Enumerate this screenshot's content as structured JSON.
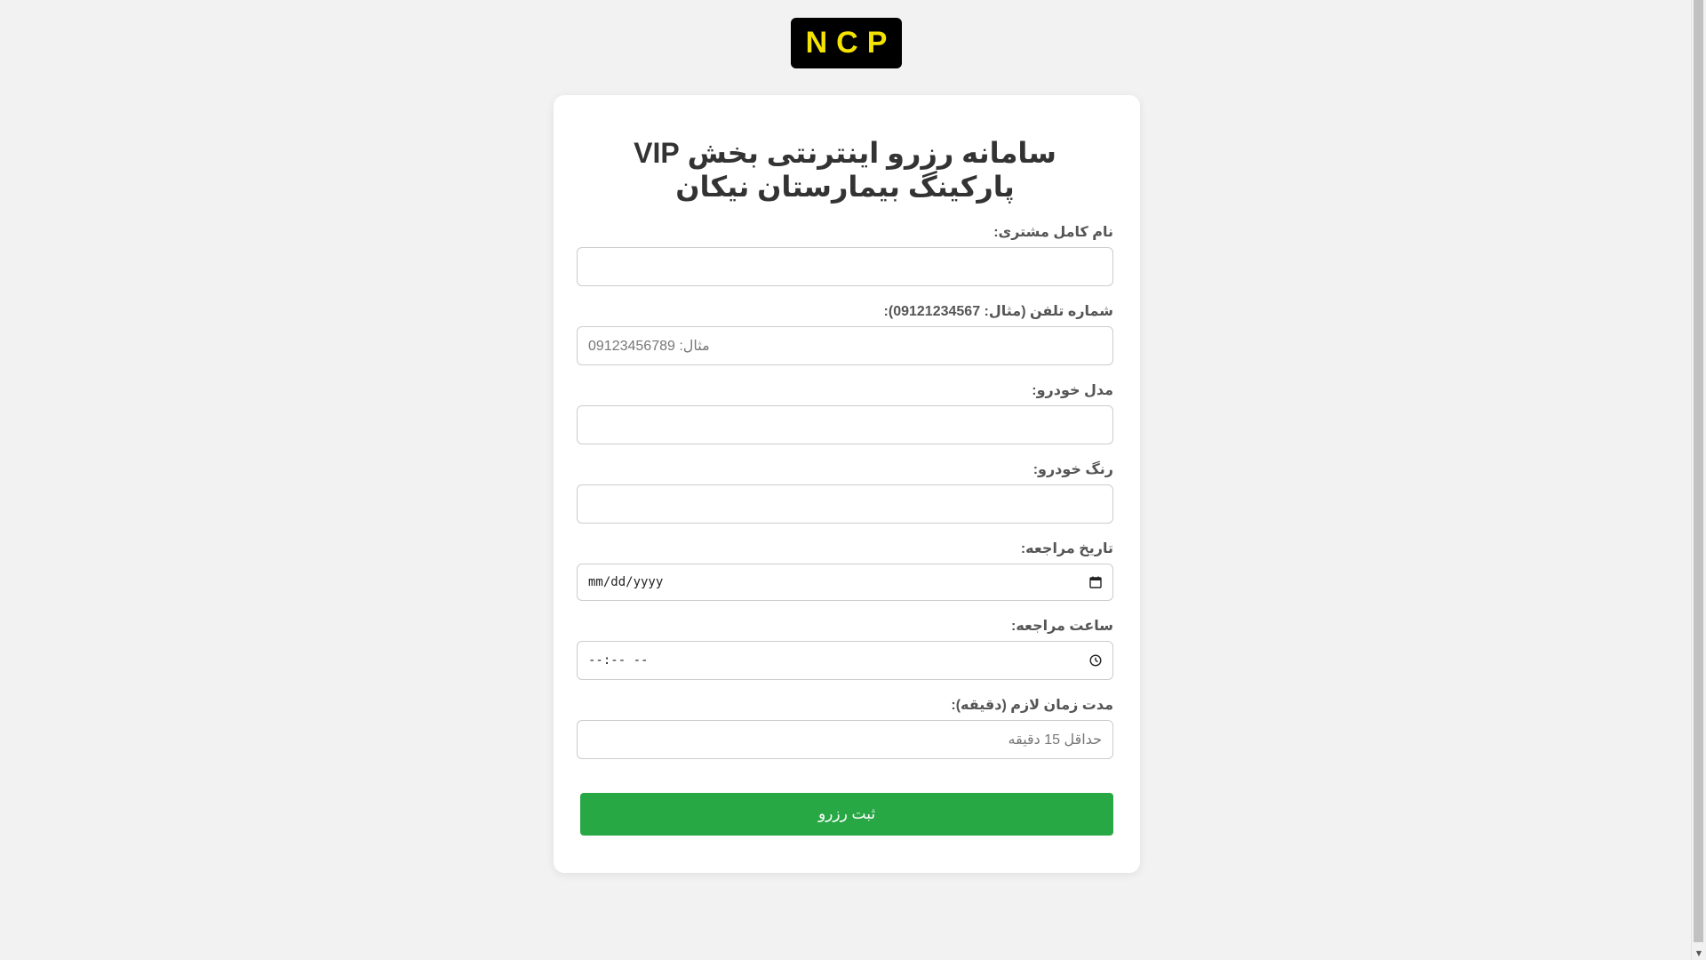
{
  "logo": {
    "text": "NCP"
  },
  "form": {
    "title": "سامانه رزرو اینترنتی بخش VIP پارکینگ بیمارستان نیکان",
    "fields": {
      "name": {
        "label": "نام کامل مشتری:",
        "value": "",
        "placeholder": ""
      },
      "phone": {
        "label": "شماره تلفن (مثال: 09121234567):",
        "value": "",
        "placeholder": "مثال: 09123456789"
      },
      "car_model": {
        "label": "مدل خودرو:",
        "value": "",
        "placeholder": ""
      },
      "car_color": {
        "label": "رنگ خودرو:",
        "value": "",
        "placeholder": ""
      },
      "date": {
        "label": "تاریخ مراجعه:",
        "display": "mm/dd/yyyy"
      },
      "time": {
        "label": "ساعت مراجعه:",
        "display": "--:-- --"
      },
      "duration": {
        "label": "مدت زمان لازم (دقیقه):",
        "placeholder": "حداقل 15 دقیقه"
      }
    },
    "submit_label": "ثبت رزرو"
  },
  "colors": {
    "background": "#f2f2f2",
    "logo_bg": "#000000",
    "logo_text": "#f4e300",
    "submit_bg": "#28a745"
  },
  "icons": {
    "date": "calendar-icon",
    "time": "clock-icon"
  }
}
